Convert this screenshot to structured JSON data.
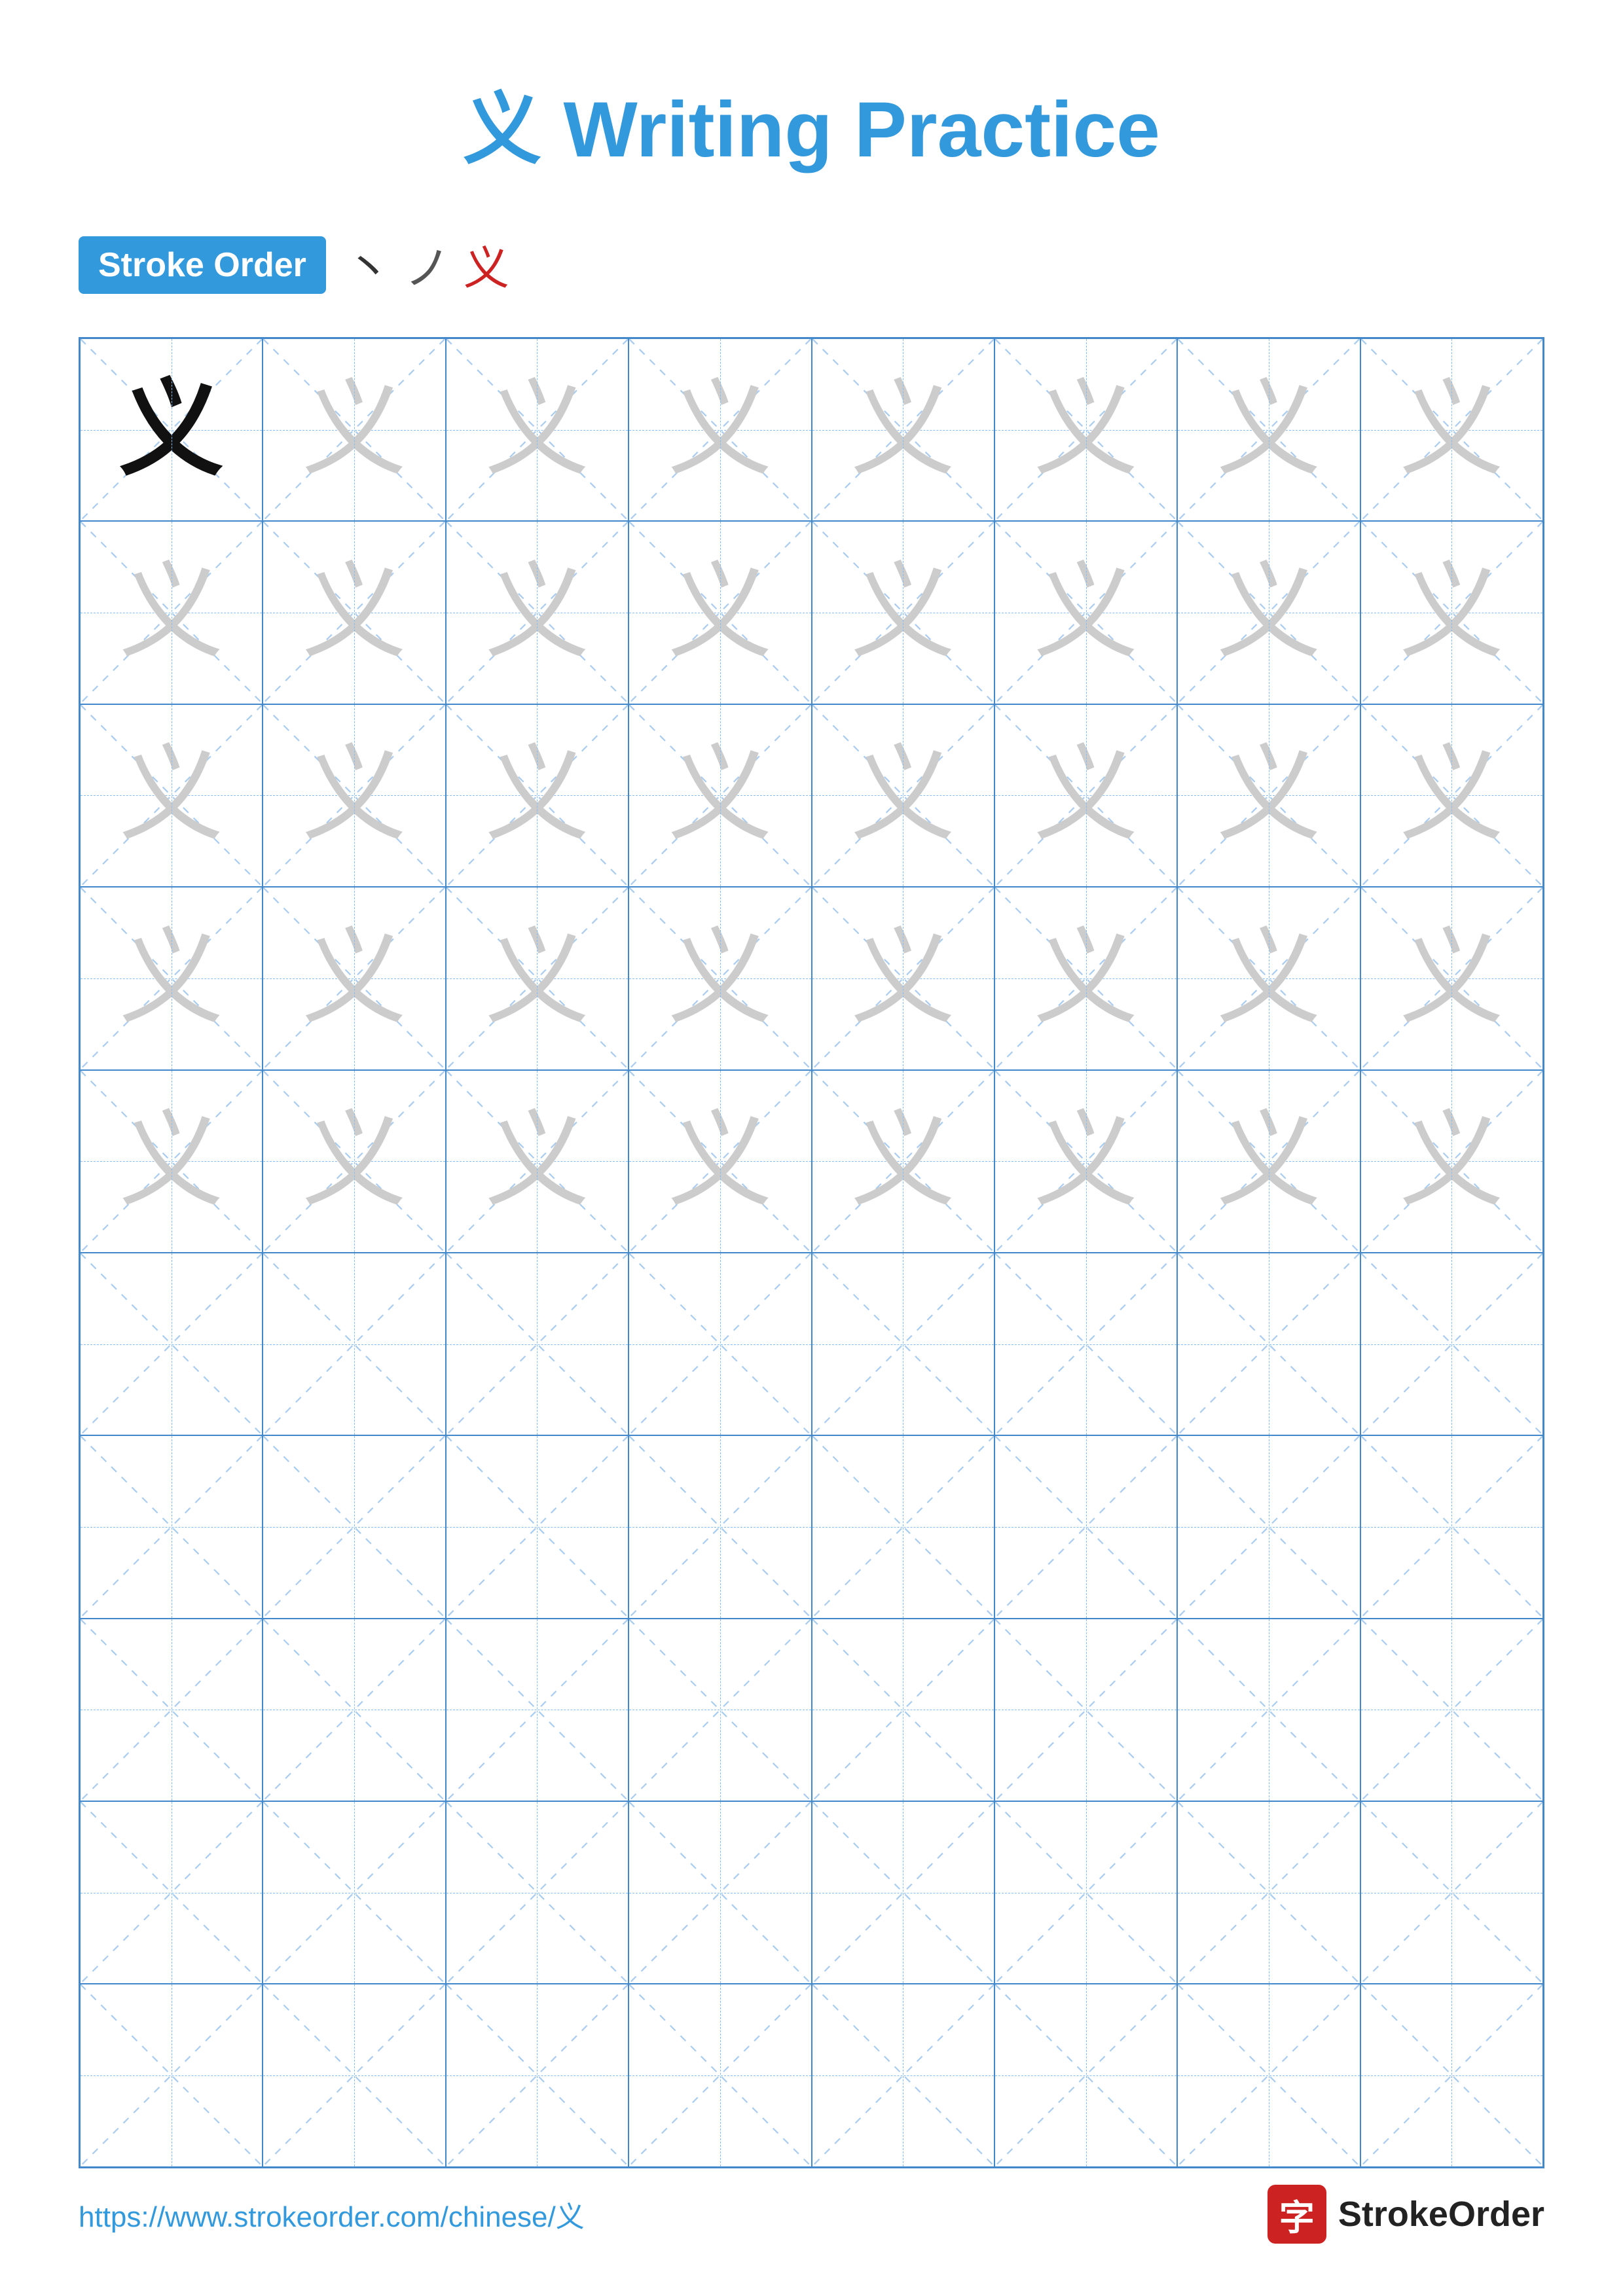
{
  "page": {
    "title_prefix": "义",
    "title_text": " Writing Practice"
  },
  "stroke_order": {
    "label": "Stroke Order",
    "chars": [
      "丶",
      "ノ",
      "义"
    ]
  },
  "grid": {
    "cols": 8,
    "rows": 10,
    "practice_char": "义"
  },
  "footer": {
    "url": "https://www.strokeorder.com/chinese/义",
    "logo_char": "字",
    "logo_name": "StrokeOrder"
  }
}
